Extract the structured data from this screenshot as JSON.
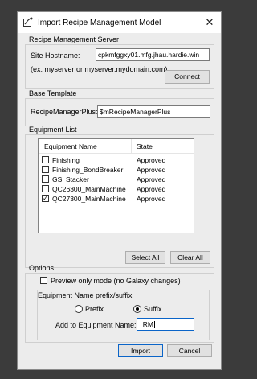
{
  "window": {
    "title": "Import Recipe Management Model",
    "close_glyph": "✕"
  },
  "server": {
    "group_label": "Recipe Management Server",
    "hostname_label": "Site Hostname:",
    "hostname_value": "cpkmfggxy01.mfg.jhau.hardie.win",
    "example_text": "(ex: myserver or myserver.mydomain.com)",
    "connect_label": "Connect"
  },
  "template": {
    "group_label": "Base Template",
    "field_label": "RecipeManagerPlus:",
    "field_value": "$mRecipeManagerPlus"
  },
  "equipment": {
    "group_label": "Equipment List",
    "columns": [
      "Equipment Name",
      "State"
    ],
    "rows": [
      {
        "name": "Finishing",
        "state": "Approved",
        "checked": false
      },
      {
        "name": "Finishing_BondBreaker",
        "state": "Approved",
        "checked": false
      },
      {
        "name": "GS_Stacker",
        "state": "Approved",
        "checked": false
      },
      {
        "name": "QC26300_MainMachine",
        "state": "Approved",
        "checked": false
      },
      {
        "name": "QC27300_MainMachine",
        "state": "Approved",
        "checked": true
      }
    ],
    "select_all_label": "Select All",
    "clear_all_label": "Clear All"
  },
  "options": {
    "group_label": "Options",
    "preview_label": "Preview only mode (no Galaxy changes)",
    "preview_checked": false,
    "prefix_group_label": "Equipment Name prefix/suffix",
    "prefix_label": "Prefix",
    "suffix_label": "Suffix",
    "selected": "suffix",
    "add_label": "Add to Equipment Name:",
    "add_value": "_RM"
  },
  "footer": {
    "import_label": "Import",
    "cancel_label": "Cancel"
  },
  "colors": {
    "background": "#3b3b3b",
    "dialog": "#ececec",
    "focus_accent": "#0a64c8"
  }
}
